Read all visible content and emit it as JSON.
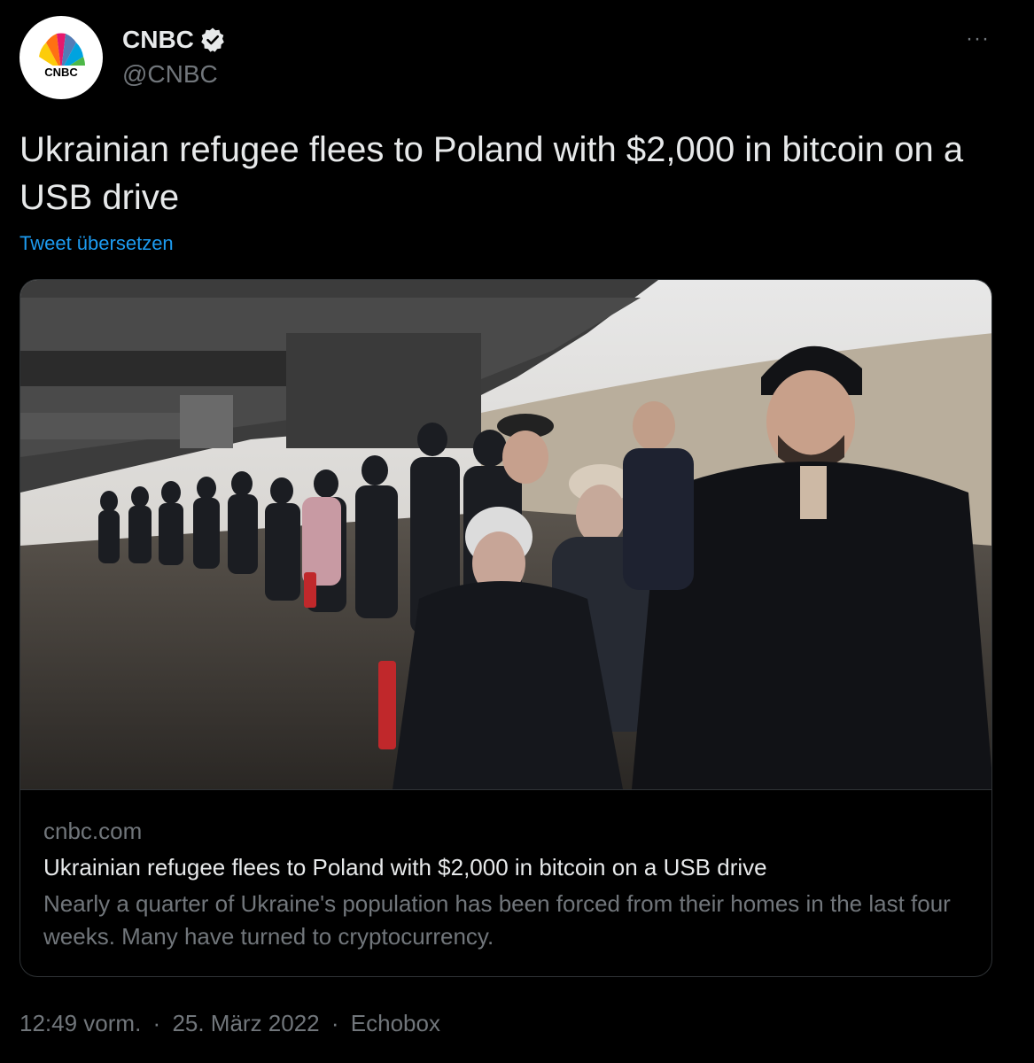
{
  "account": {
    "name": "CNBC",
    "handle": "@CNBC",
    "logo_text": "CNBC",
    "verified": true
  },
  "more_menu": {
    "label": "···"
  },
  "tweet": {
    "text": "Ukrainian refugee flees to Poland with $2,000 in bitcoin on a USB drive",
    "translate_label": "Tweet übersetzen"
  },
  "card": {
    "domain": "cnbc.com",
    "title": "Ukrainian refugee flees to Poland with $2,000 in bitcoin on a USB drive",
    "description": "Nearly a quarter of Ukraine's population has been forced from their homes in the last four weeks. Many have turned to cryptocurrency."
  },
  "meta": {
    "time": "12:49 vorm.",
    "separator": "·",
    "date": "25. März 2022",
    "source": "Echobox"
  },
  "colors": {
    "background": "#000000",
    "text_primary": "#e7e9ea",
    "text_secondary": "#71767b",
    "link": "#1d9bf0",
    "border": "#2f3336"
  }
}
